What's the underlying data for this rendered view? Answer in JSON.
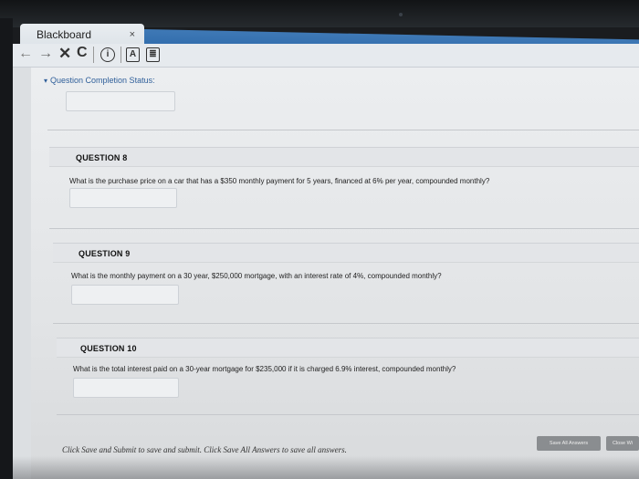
{
  "browser": {
    "tab_title": "Blackboard",
    "tab_close": "×",
    "nav": {
      "back": "←",
      "forward": "→",
      "stop": "✕",
      "reload": "C",
      "info": "i",
      "reader": "A",
      "bookmark": "≣"
    }
  },
  "status": {
    "chevron": "▾",
    "label": "Question Completion Status:"
  },
  "questions": [
    {
      "title": "QUESTION 8",
      "text": "What is the purchase price on a car that has a $350 monthly payment for 5 years, financed at 6% per year, compounded monthly?"
    },
    {
      "title": "QUESTION 9",
      "text": "What is the monthly payment on a 30 year, $250,000 mortgage, with an interest rate of 4%, compounded monthly?"
    },
    {
      "title": "QUESTION 10",
      "text": "What is the total interest paid on a 30-year mortgage for $235,000 if it is charged 6.9% interest, compounded monthly?"
    }
  ],
  "footer": {
    "instruction": "Click Save and Submit to save and submit. Click Save All Answers to save all answers.",
    "save_all_label": "Save All Answers",
    "close_window_label": "Close Wi"
  }
}
